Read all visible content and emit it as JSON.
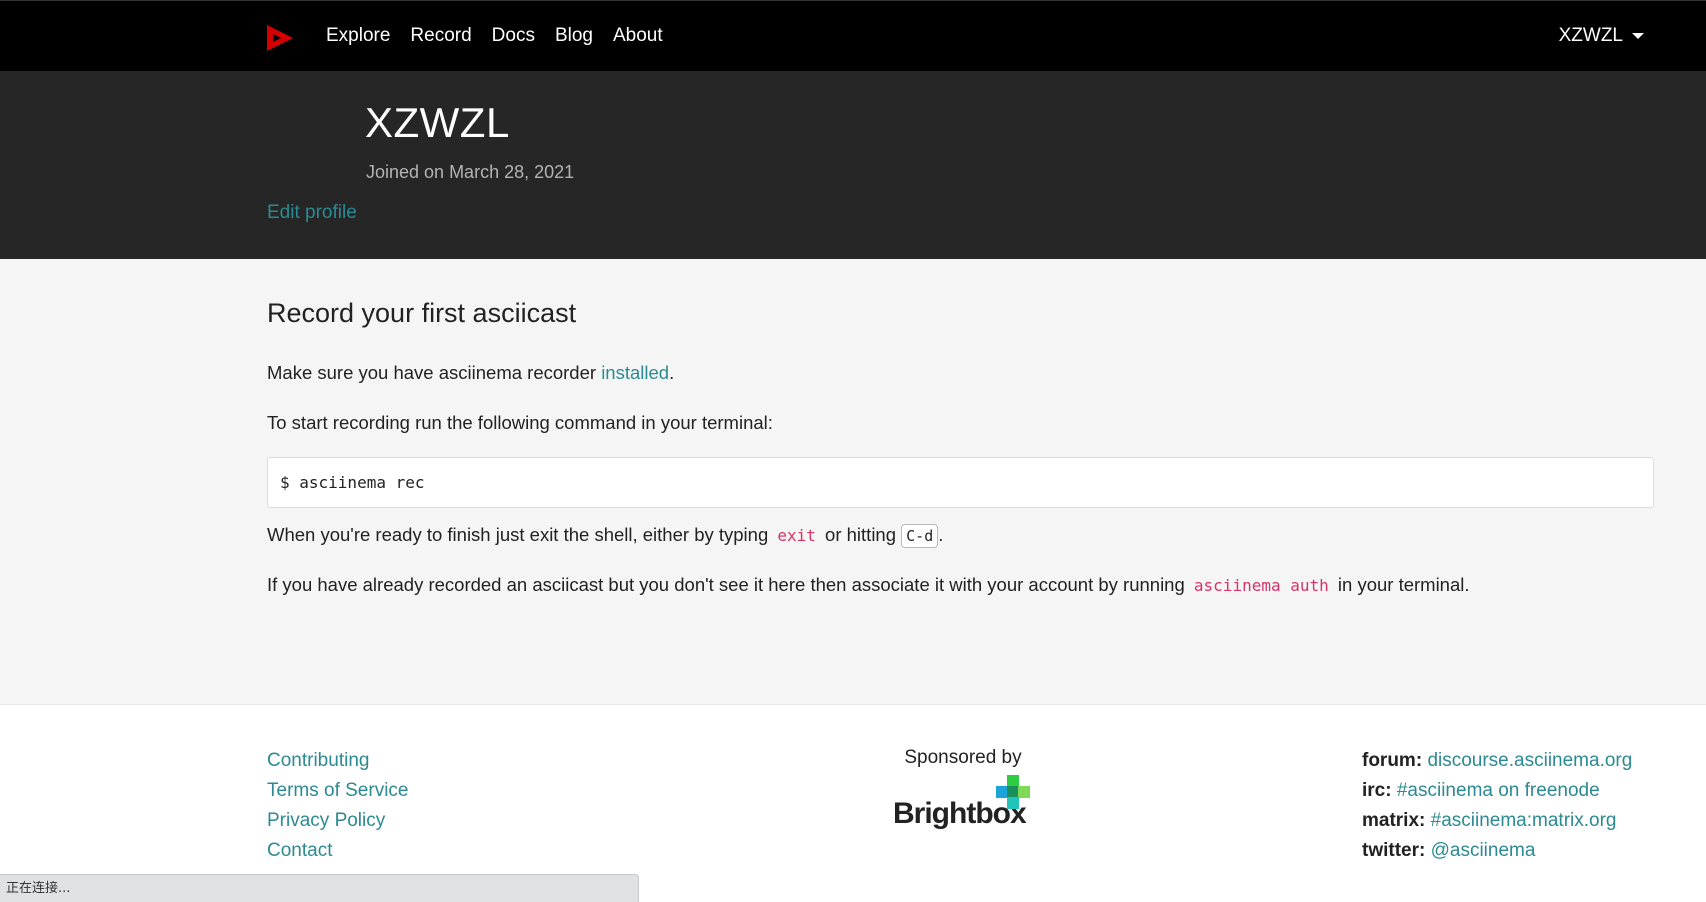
{
  "nav": {
    "logo_icon": "asciinema-play-logo-icon",
    "links": [
      "Explore",
      "Record",
      "Docs",
      "Blog",
      "About"
    ],
    "user": "XZWZL"
  },
  "profile": {
    "username": "XZWZL",
    "joined": "Joined on March 28, 2021",
    "edit_profile": "Edit profile"
  },
  "main": {
    "heading": "Record your first asciicast",
    "p1_before": "Make sure you have asciinema recorder ",
    "p1_link": "installed",
    "p1_after": ".",
    "p2": "To start recording run the following command in your terminal:",
    "command": "$ asciinema rec",
    "p3_before": "When you're ready to finish just exit the shell, either by typing ",
    "p3_code": "exit",
    "p3_middle": " or hitting ",
    "p3_key": "C-d",
    "p3_after": ".",
    "p4_before": "If you have already recorded an asciicast but you don't see it here then associate it with your account by running ",
    "p4_code": "asciinema auth",
    "p4_after": " in your terminal."
  },
  "footer": {
    "links": [
      "Contributing",
      "Terms of Service",
      "Privacy Policy",
      "Contact"
    ],
    "sponsored_by": "Sponsored by",
    "sponsor_name": "Brightbox",
    "community": [
      {
        "label": "forum:",
        "value": "discourse.asciinema.org"
      },
      {
        "label": "irc:",
        "value": "#asciinema on freenode"
      },
      {
        "label": "matrix:",
        "value": "#asciinema:matrix.org"
      },
      {
        "label": "twitter:",
        "value": "@asciinema"
      }
    ]
  },
  "statusbar": {
    "text": "正在连接..."
  },
  "colors": {
    "accent": "#2b8a92",
    "logo_red": "#d40000",
    "code_pink": "#d6336c"
  }
}
